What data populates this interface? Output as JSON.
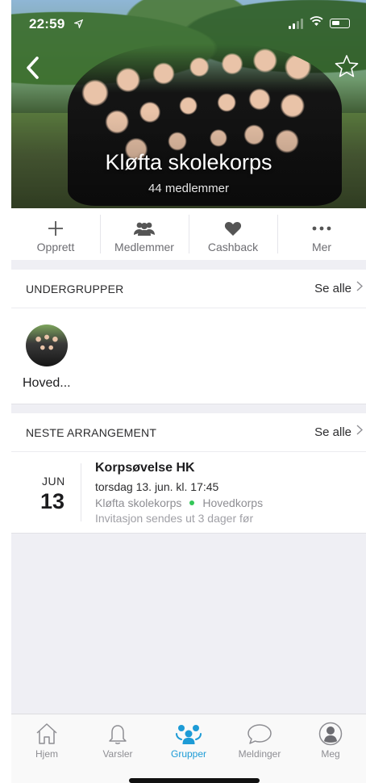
{
  "status_bar": {
    "time": "22:59"
  },
  "header": {
    "title": "Kløfta skolekorps",
    "subtitle": "44 medlemmer"
  },
  "actions": [
    {
      "label": "Opprett",
      "icon": "plus-icon"
    },
    {
      "label": "Medlemmer",
      "icon": "members-icon"
    },
    {
      "label": "Cashback",
      "icon": "heart-icon"
    },
    {
      "label": "Mer",
      "icon": "more-icon"
    }
  ],
  "subgroups": {
    "title": "UNDERGRUPPER",
    "see_all": "Se alle",
    "items": [
      {
        "name": "Hoved..."
      }
    ]
  },
  "next_event": {
    "title": "NESTE ARRANGEMENT",
    "see_all": "Se alle",
    "event": {
      "month": "JUN",
      "day": "13",
      "name": "Korpsøvelse HK",
      "time": "torsdag 13. jun. kl. 17:45",
      "group": "Kløfta skolekorps",
      "subgroup": "Hovedkorps",
      "invite": "Invitasjon sendes ut 3 dager før"
    }
  },
  "tabbar": {
    "items": [
      {
        "label": "Hjem",
        "icon": "home-icon"
      },
      {
        "label": "Varsler",
        "icon": "bell-icon"
      },
      {
        "label": "Grupper",
        "icon": "groups-icon",
        "active": true
      },
      {
        "label": "Meldinger",
        "icon": "chat-icon"
      },
      {
        "label": "Meg",
        "icon": "profile-icon"
      }
    ]
  },
  "colors": {
    "accent": "#1d9bd6",
    "active_dot": "#34c759",
    "background": "#efeff4"
  }
}
